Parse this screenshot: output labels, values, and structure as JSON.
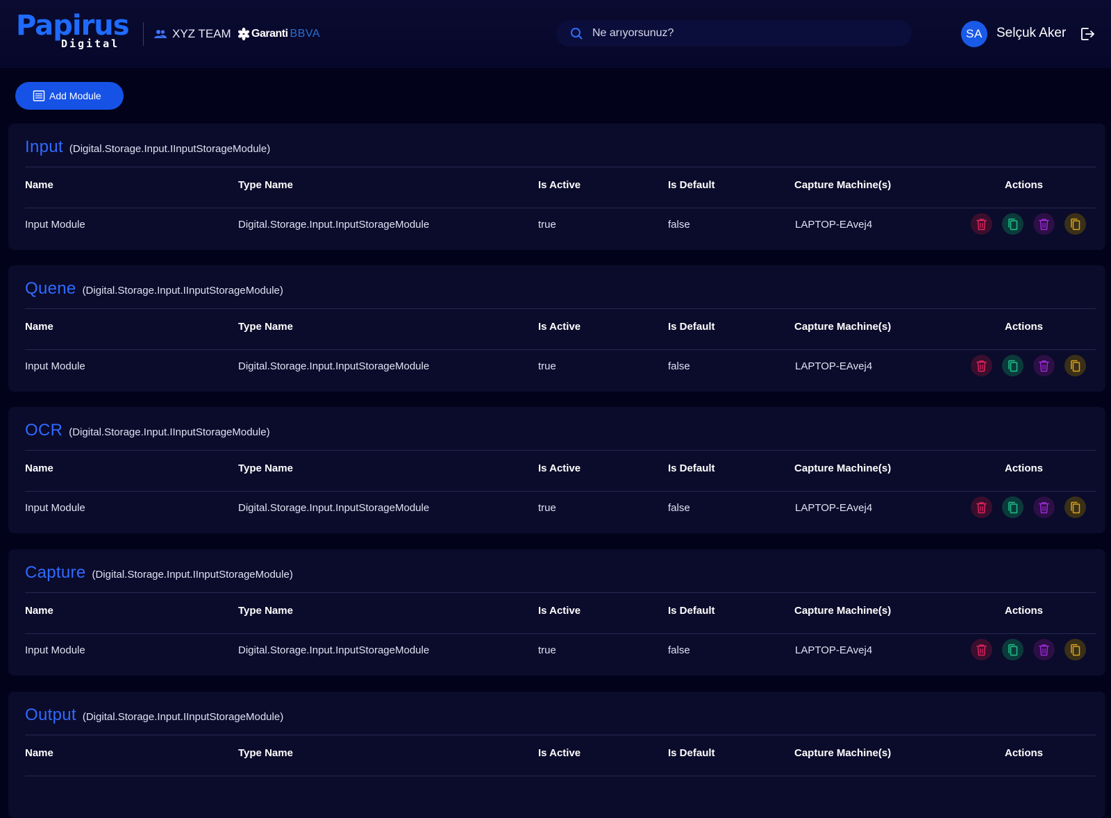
{
  "brand": {
    "name": "Papirus",
    "sub": "Digital",
    "logo_color": "#1f6bff"
  },
  "team": {
    "label": "XYZ TEAM"
  },
  "bank": {
    "name": "Garanti",
    "suffix": "BBVA"
  },
  "search": {
    "placeholder": "Ne arıyorsunuz?"
  },
  "user": {
    "initials": "SA",
    "name": "Selçuk Aker"
  },
  "toolbar": {
    "add_module_label": "Add Module"
  },
  "columns": {
    "name": "Name",
    "type_name": "Type Name",
    "is_active": "Is Active",
    "is_default": "Is Default",
    "capture_machines": "Capture Machine(s)",
    "actions": "Actions"
  },
  "sections": [
    {
      "title": "Input",
      "interface": "(Digital.Storage.Input.IInputStorageModule)",
      "rows": [
        {
          "name": "Input Module",
          "type_name": "Digital.Storage.Input.InputStorageModule",
          "is_active": "true",
          "is_default": "false",
          "capture_machine": "LAPTOP-EAvej4"
        }
      ]
    },
    {
      "title": "Quene",
      "interface": "(Digital.Storage.Input.IInputStorageModule)",
      "rows": [
        {
          "name": "Input Module",
          "type_name": "Digital.Storage.Input.InputStorageModule",
          "is_active": "true",
          "is_default": "false",
          "capture_machine": "LAPTOP-EAvej4"
        }
      ]
    },
    {
      "title": "OCR",
      "interface": "(Digital.Storage.Input.IInputStorageModule)",
      "rows": [
        {
          "name": "Input Module",
          "type_name": "Digital.Storage.Input.InputStorageModule",
          "is_active": "true",
          "is_default": "false",
          "capture_machine": "LAPTOP-EAvej4"
        }
      ]
    },
    {
      "title": "Capture",
      "interface": "(Digital.Storage.Input.IInputStorageModule)",
      "rows": [
        {
          "name": "Input Module",
          "type_name": "Digital.Storage.Input.InputStorageModule",
          "is_active": "true",
          "is_default": "false",
          "capture_machine": "LAPTOP-EAvej4"
        }
      ]
    },
    {
      "title": "Output",
      "interface": "(Digital.Storage.Input.IInputStorageModule)",
      "rows": []
    }
  ],
  "row_actions": [
    {
      "icon": "trash-icon",
      "color": "#e0245e"
    },
    {
      "icon": "copy-icon",
      "color": "#1fc28a"
    },
    {
      "icon": "trash-icon",
      "color": "#9b2bd6"
    },
    {
      "icon": "copy-icon",
      "color": "#d9a21b"
    }
  ],
  "colors": {
    "accent": "#1652e6",
    "background": "#02021a",
    "panel": "#0b0b2b"
  }
}
